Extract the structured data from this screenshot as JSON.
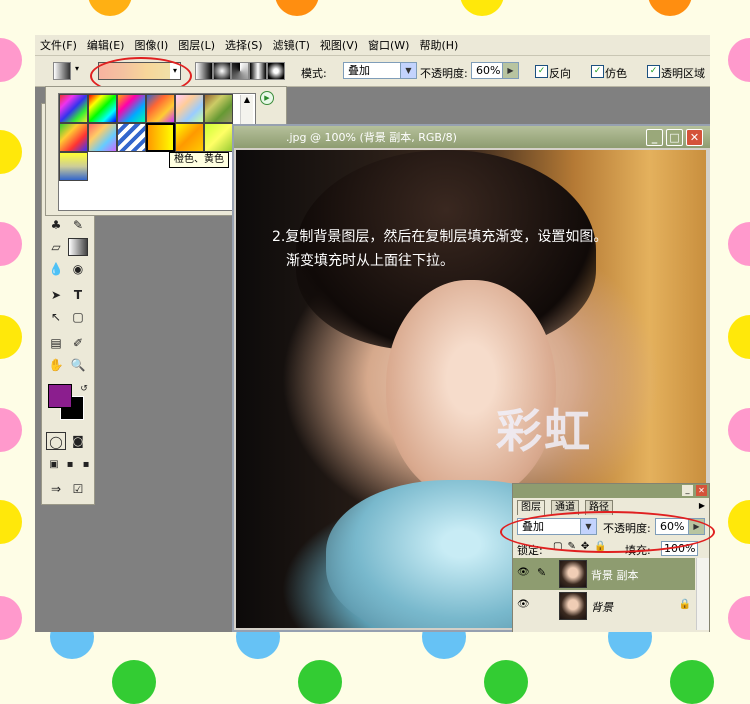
{
  "menubar": {
    "items": [
      "文件(F)",
      "编辑(E)",
      "图像(I)",
      "图层(L)",
      "选择(S)",
      "滤镜(T)",
      "视图(V)",
      "窗口(W)",
      "帮助(H)"
    ]
  },
  "options_bar": {
    "mode_label": "模式:",
    "mode_value": "叠加",
    "opacity_label": "不透明度:",
    "opacity_value": "60%",
    "reverse_label": "反向",
    "dither_label": "仿色",
    "transparency_label": "透明区域"
  },
  "gradient_picker": {
    "tooltip": "橙色、黄色",
    "menu_icon": "play-circle-icon"
  },
  "document": {
    "title": ".jpg @ 100% (背景 副本, RGB/8)",
    "caption_line1": "2.复制背景图层，然后在复制层填充渐变，设置如图。",
    "caption_line2": "渐变填充时从上面往下拉。",
    "watermark": "彩虹"
  },
  "layers_panel": {
    "tabs": [
      "图层",
      "通道",
      "路径"
    ],
    "blend_mode": "叠加",
    "opacity_label": "不透明度:",
    "opacity_value": "60%",
    "lock_label": "锁定:",
    "fill_label": "填充:",
    "fill_value": "100%",
    "layers": [
      {
        "name": "背景 副本",
        "selected": true
      },
      {
        "name": "背景",
        "selected": false
      }
    ]
  },
  "colors": {
    "foreground": "#8b1e8e",
    "background": "#000000",
    "accent_oval": "#e02020"
  }
}
